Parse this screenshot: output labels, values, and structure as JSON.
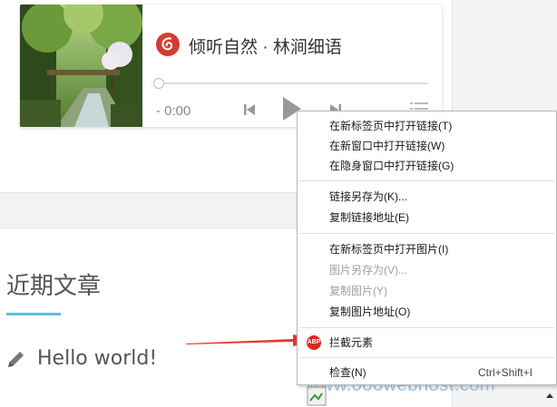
{
  "player": {
    "song_title": "倾听自然 · 林涧细语",
    "time": "- 0:00",
    "icons": {
      "logo": "netease-music-icon",
      "prev": "skip-previous-icon",
      "play": "play-icon",
      "next": "skip-next-icon",
      "list": "playlist-icon"
    },
    "brand_color": "#d43c33"
  },
  "sidebar": {
    "recent_heading": "近期文章",
    "posts": [
      {
        "title": "Hello world!",
        "icon": "pencil-icon"
      }
    ]
  },
  "watermark": "www.000webhost.com",
  "context_menu": {
    "groups": [
      [
        {
          "label": "在新标签页中打开链接(T)",
          "disabled": false
        },
        {
          "label": "在新窗口中打开链接(W)",
          "disabled": false
        },
        {
          "label": "在隐身窗口中打开链接(G)",
          "disabled": false
        }
      ],
      [
        {
          "label": "链接另存为(K)...",
          "disabled": false
        },
        {
          "label": "复制链接地址(E)",
          "disabled": false
        }
      ],
      [
        {
          "label": "在新标签页中打开图片(I)",
          "disabled": false
        },
        {
          "label": "图片另存为(V)...",
          "disabled": true
        },
        {
          "label": "复制图片(Y)",
          "disabled": true
        },
        {
          "label": "复制图片地址(O)",
          "disabled": false
        }
      ],
      [
        {
          "label": "拦截元素",
          "disabled": false,
          "icon": "adblock-icon",
          "icon_text": "ABP"
        }
      ],
      [
        {
          "label": "检查(N)",
          "disabled": false,
          "shortcut": "Ctrl+Shift+I"
        }
      ]
    ]
  },
  "annotation": {
    "arrow_color": "#e53935"
  }
}
